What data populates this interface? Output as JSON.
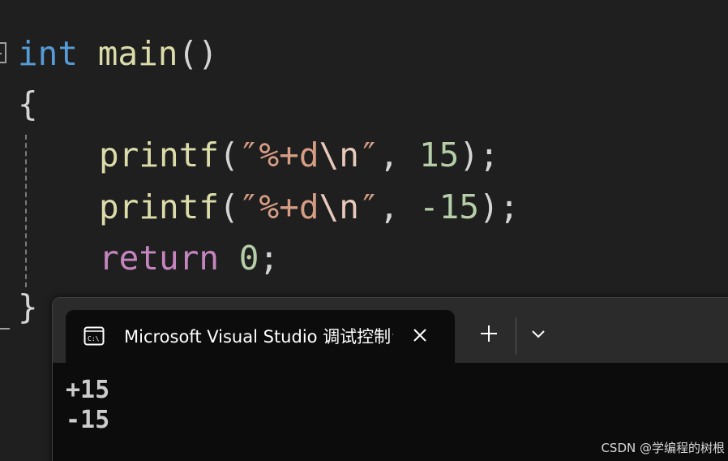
{
  "editor": {
    "lines": {
      "l1": {
        "kw": "int",
        "fn": "main",
        "punc": "()"
      },
      "l2": {
        "brace": "{"
      },
      "l3": {
        "fn": "printf",
        "open": "(",
        "str1": "″",
        "fmt": "%+d",
        "esc": "\\n",
        "str2": "″",
        "comma": ", ",
        "num": "15",
        "close": ");"
      },
      "l4": {
        "fn": "printf",
        "open": "(",
        "str1": "″",
        "fmt": "%+d",
        "esc": "\\n",
        "str2": "″",
        "comma": ", ",
        "num": "-15",
        "close": ");"
      },
      "l5": {
        "kw": "return",
        "num": "0",
        "close": ";"
      },
      "l6": {
        "brace": "}"
      }
    }
  },
  "terminal": {
    "tab_title": "Microsoft Visual Studio 调试控制台",
    "icons": {
      "tab": "console-icon",
      "close": "close-icon",
      "new_tab": "plus-icon",
      "dropdown": "chevron-down-icon"
    },
    "output": [
      "+15",
      "-15"
    ]
  },
  "watermark": "CSDN @学编程的树根",
  "colors": {
    "background": "#1f1f1f",
    "keyword": "#569cd6",
    "function": "#dcdcaa",
    "string": "#d69d85",
    "number": "#b5cea8",
    "control": "#c586c0",
    "terminal_bg": "#0c0c0c"
  }
}
